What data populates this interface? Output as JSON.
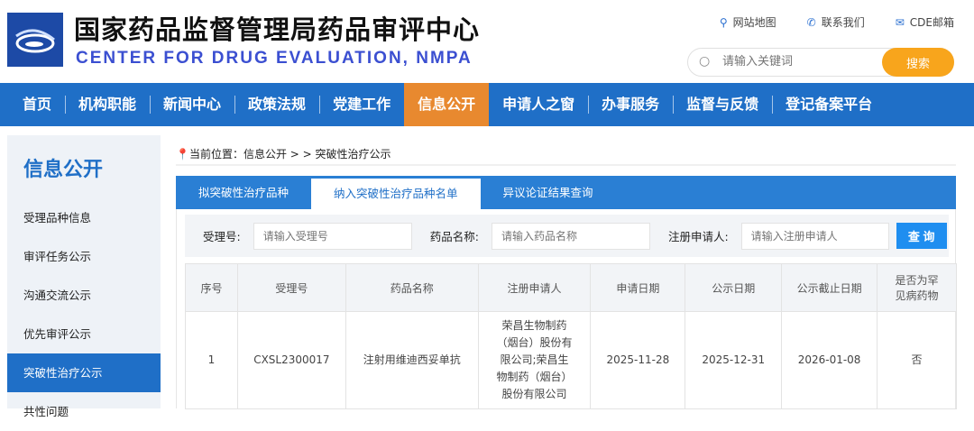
{
  "header": {
    "title_cn": "国家药品监督管理局药品审评中心",
    "title_en": "CENTER FOR DRUG EVALUATION, NMPA",
    "links": [
      {
        "icon": "map-pin-icon",
        "label": "网站地图"
      },
      {
        "icon": "phone-icon",
        "label": "联系我们"
      },
      {
        "icon": "mail-icon",
        "label": "CDE邮箱"
      }
    ],
    "search": {
      "placeholder": "请输入关键词",
      "button": "搜索"
    }
  },
  "nav": [
    "首页",
    "机构职能",
    "新闻中心",
    "政策法规",
    "党建工作",
    "信息公开",
    "申请人之窗",
    "办事服务",
    "监督与反馈",
    "登记备案平台"
  ],
  "sidebar": {
    "title": "信息公开",
    "items": [
      "受理品种信息",
      "审评任务公示",
      "沟通交流公示",
      "优先审评公示",
      "突破性治疗公示",
      "共性问题"
    ]
  },
  "breadcrumb": "当前位置：信息公开 > >  突破性治疗公示",
  "tabs": [
    "拟突破性治疗品种",
    "纳入突破性治疗品种名单",
    "异议论证结果查询"
  ],
  "filter": {
    "fields": [
      {
        "label": "受理号:",
        "placeholder": "请输入受理号"
      },
      {
        "label": "药品名称:",
        "placeholder": "请输入药品名称"
      },
      {
        "label": "注册申请人:",
        "placeholder": "请输入注册申请人"
      }
    ],
    "button": "查 询"
  },
  "table": {
    "headers": [
      "序号",
      "受理号",
      "药品名称",
      "注册申请人",
      "申请日期",
      "公示日期",
      "公示截止日期",
      "是否为罕见病药物"
    ],
    "rows": [
      [
        "1",
        "CXSL2300017",
        "注射用维迪西妥单抗",
        "荣昌生物制药（烟台）股份有限公司;荣昌生物制药（烟台）股份有限公司",
        "2025-11-28",
        "2025-12-31",
        "2026-01-08",
        "否"
      ]
    ]
  }
}
